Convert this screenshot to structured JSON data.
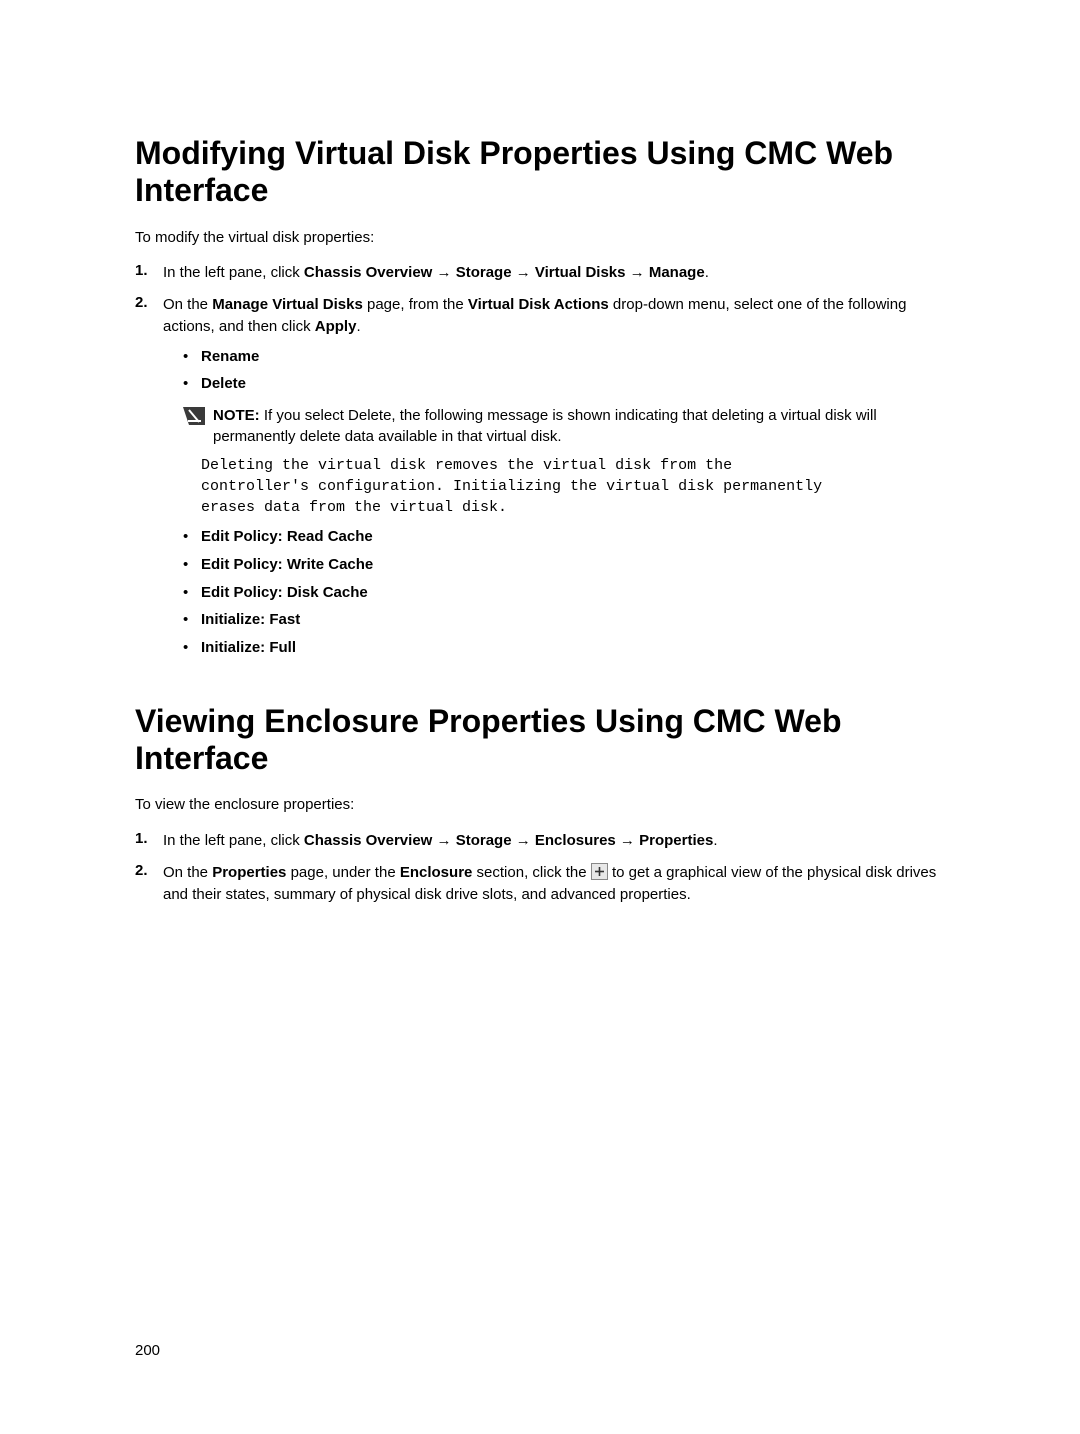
{
  "section1": {
    "title": "Modifying Virtual Disk Properties Using CMC Web Interface",
    "intro": "To modify the virtual disk properties:",
    "step1_num": "1.",
    "step1_pre": "In the left pane, click ",
    "step1_b1": "Chassis Overview",
    "step1_arr1": " → ",
    "step1_b2": "Storage",
    "step1_arr2": " → ",
    "step1_b3": "Virtual Disks",
    "step1_arr3": " → ",
    "step1_b4": "Manage",
    "step1_post": ".",
    "step2_num": "2.",
    "step2_p1": "On the ",
    "step2_b1": "Manage Virtual Disks",
    "step2_p2": " page, from the ",
    "step2_b2": "Virtual Disk Actions",
    "step2_p3": " drop-down menu, select one of the following actions, and then click ",
    "step2_b3": "Apply",
    "step2_p4": ".",
    "bullet_rename": "Rename",
    "bullet_delete": "Delete",
    "note_label": "NOTE: ",
    "note_text": "If you select Delete, the following message is shown indicating that deleting a virtual disk will permanently delete data available in that virtual disk.",
    "code_text": "Deleting the virtual disk removes the virtual disk from the \ncontroller's configuration. Initializing the virtual disk permanently \nerases data from the virtual disk.",
    "bullet_read": "Edit Policy: Read Cache",
    "bullet_write": "Edit Policy: Write Cache",
    "bullet_disk": "Edit Policy: Disk Cache",
    "bullet_fast": "Initialize: Fast",
    "bullet_full": "Initialize: Full"
  },
  "section2": {
    "title": "Viewing Enclosure Properties Using CMC Web Interface",
    "intro": "To view the enclosure properties:",
    "step1_num": "1.",
    "step1_pre": "In the left pane, click ",
    "step1_b1": "Chassis Overview",
    "step1_arr1": " → ",
    "step1_b2": "Storage",
    "step1_arr2": " → ",
    "step1_b3": "Enclosures",
    "step1_arr3": " → ",
    "step1_b4": "Properties",
    "step1_post": ".",
    "step2_num": "2.",
    "step2_p1": "On the ",
    "step2_b1": "Properties",
    "step2_p2": " page, under the ",
    "step2_b2": "Enclosure",
    "step2_p3": " section, click the ",
    "step2_p4": " to get a graphical view of the physical disk drives and their states, summary of physical disk drive slots, and advanced properties."
  },
  "page_number": "200"
}
